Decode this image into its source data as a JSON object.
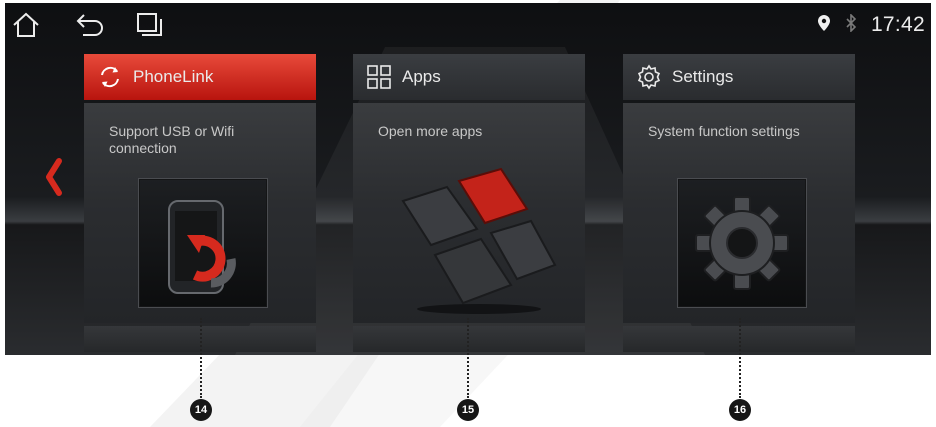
{
  "statusbar": {
    "home_icon": "home-icon",
    "back_icon": "back-icon",
    "recents_icon": "recent-apps-icon",
    "location_icon": "location-pin-icon",
    "bluetooth_icon": "bluetooth-icon",
    "time": "17:42"
  },
  "nav": {
    "prev_icon": "chevron-left-icon",
    "accent": "#d62a1e"
  },
  "cards": [
    {
      "title": "PhoneLink",
      "icon": "sync-icon",
      "description": "Support USB or Wifi connection",
      "image": "phone-sync-illustration",
      "active": true,
      "callout": "14"
    },
    {
      "title": "Apps",
      "icon": "grid-icon",
      "description": "Open more apps",
      "image": "app-tiles-illustration",
      "active": false,
      "callout": "15"
    },
    {
      "title": "Settings",
      "icon": "gear-icon",
      "description": "System function settings",
      "image": "gear-illustration",
      "active": false,
      "callout": "16"
    }
  ]
}
